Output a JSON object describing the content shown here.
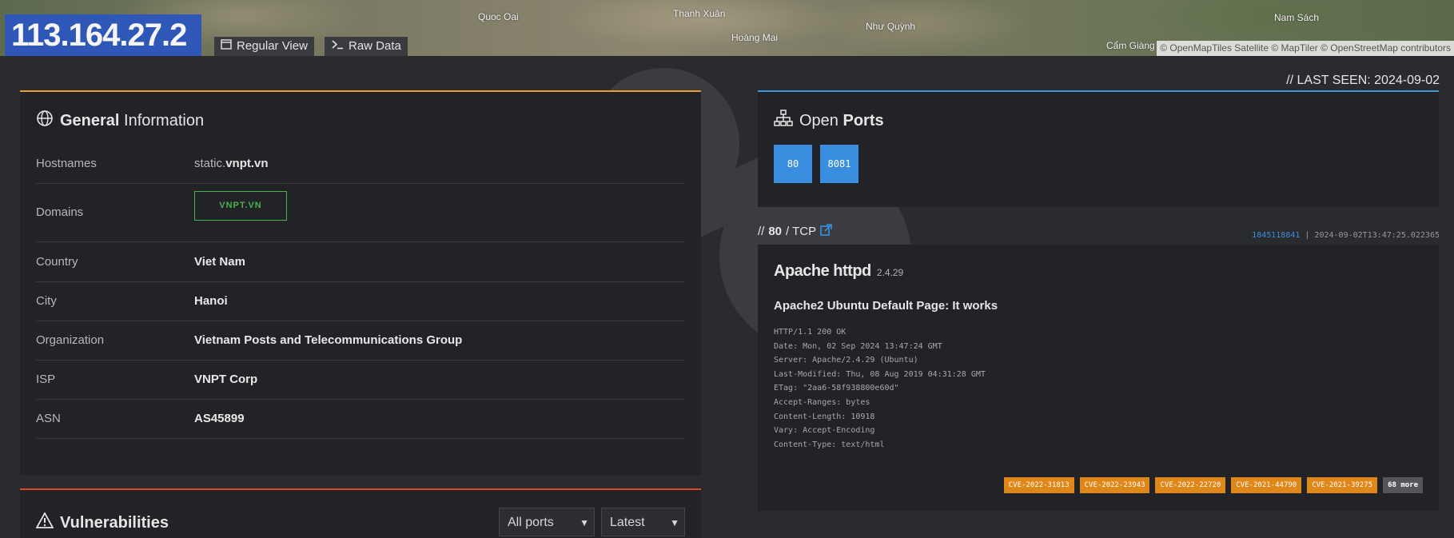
{
  "map": {
    "labels": [
      "Quoc Oai",
      "Thanh Xuân",
      "Hoàng Mai",
      "Như Quỳnh",
      "Nam Sách",
      "Cẩm Giàng"
    ],
    "attribution": "© OpenMapTiles Satellite  © MapTiler © OpenStreetMap contributors"
  },
  "header": {
    "ip": "113.164.27.2",
    "regular_view": "Regular View",
    "raw_data": "Raw Data"
  },
  "general": {
    "title_bold": "General",
    "title_rest": " Information",
    "rows": [
      {
        "label": "Hostnames",
        "value_prefix": "static.",
        "value_bold": "vnpt.vn"
      },
      {
        "label": "Domains",
        "value": "VNPT.VN"
      },
      {
        "label": "Country",
        "value": "Viet Nam"
      },
      {
        "label": "City",
        "value": "Hanoi"
      },
      {
        "label": "Organization",
        "value": "Vietnam Posts and Telecommunications Group"
      },
      {
        "label": "ISP",
        "value": "VNPT Corp"
      },
      {
        "label": "ASN",
        "value": "AS45899"
      }
    ]
  },
  "last_seen": "// LAST SEEN: 2024-09-02",
  "ports": {
    "title_rest": "Open ",
    "title_bold": "Ports",
    "list": [
      "80",
      "8081"
    ]
  },
  "service": {
    "port_prefix": "// ",
    "port": "80",
    "proto": " / TCP",
    "hash": "1845118841",
    "timestamp": " | 2024-09-02T13:47:25.022365",
    "product": "Apache httpd",
    "version": "2.4.29",
    "page_title": "Apache2 Ubuntu Default Page: It works",
    "http_lines": "HTTP/1.1 200 OK\nDate: Mon, 02 Sep 2024 13:47:24 GMT\nServer: Apache/2.4.29 (Ubuntu)\nLast-Modified: Thu, 08 Aug 2019 04:31:28 GMT\nETag: \"2aa6-58f938800e60d\"\nAccept-Ranges: bytes\nContent-Length: 10918\nVary: Accept-Encoding\nContent-Type: text/html",
    "cves": [
      "CVE-2022-31813",
      "CVE-2022-23943",
      "CVE-2022-22720",
      "CVE-2021-44790",
      "CVE-2021-39275"
    ],
    "more": "68 more"
  },
  "vulns": {
    "title": "Vulnerabilities",
    "ports_select": "All ports",
    "sort_select": "Latest"
  },
  "colors": {
    "ip_highlight": "#2e57b7",
    "general_accent": "#e8a033",
    "ports_accent": "#3d97d9",
    "vulns_accent": "#e0462c",
    "port_chip": "#3a8ee0",
    "cve_badge": "#e0871a",
    "domain_tag": "#4caf50"
  }
}
